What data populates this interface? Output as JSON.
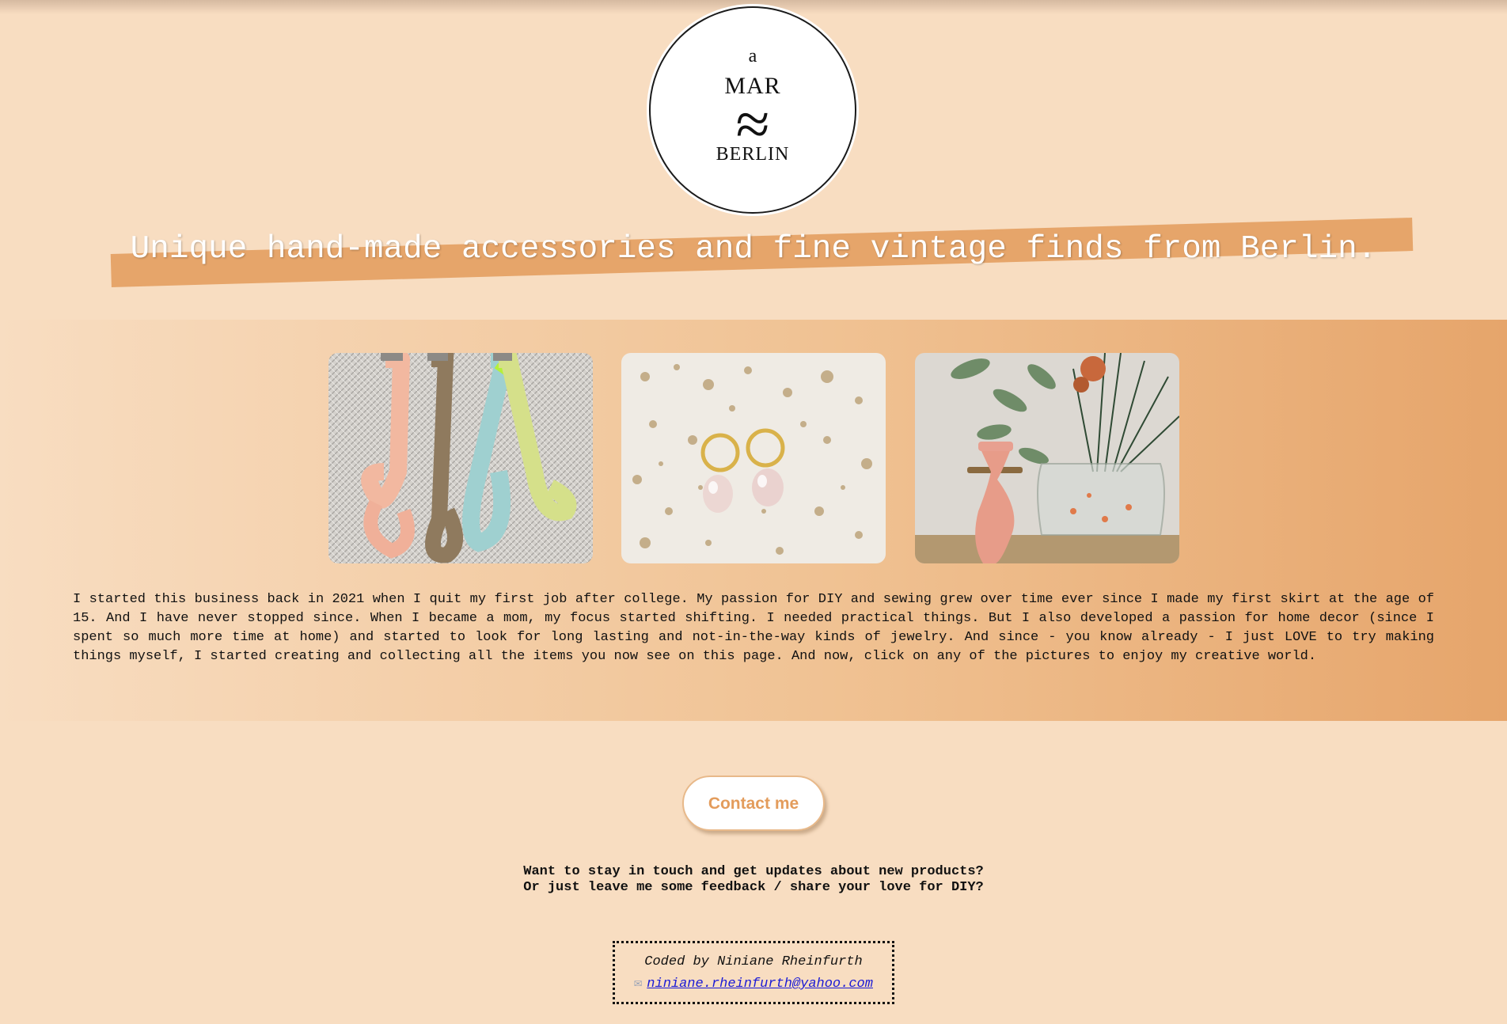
{
  "logo": {
    "line1": "a",
    "line2": "MAR",
    "line3": "≈",
    "line4": "BERLIN"
  },
  "tagline": "Unique hand-made accessories and fine vintage finds from Berlin.",
  "gallery": {
    "items": [
      {
        "name": "ribbon-straps-photo"
      },
      {
        "name": "pearl-earrings-photo"
      },
      {
        "name": "pink-vase-photo"
      }
    ]
  },
  "story": "I started this business back in 2021 when I quit my first job after college. My passion for DIY and sewing grew over time ever since I made my first skirt at the age of 15. And I have never stopped since. When I became a mom, my focus started shifting. I needed practical things. But I also developed a passion for home decor (since I spent so much more time at home) and started to look for long lasting and not-in-the-way kinds of jewelry. And since - you know already - I just LOVE to try making things myself, I started creating and collecting all the items you now see on this page. And now, click on any of the pictures to enjoy my creative world.",
  "contact": {
    "button_label": "Contact me"
  },
  "stay": {
    "line1": "Want to stay in touch and get updates about new products?",
    "line2": "Or just leave me some feedback / share your love for DIY?"
  },
  "footer": {
    "credit": "Coded by Niniane Rheinfurth",
    "email": "niniane.rheinfurth@yahoo.com",
    "mail_icon": "envelope-icon"
  },
  "colors": {
    "background": "#f8ddc1",
    "accent": "#e6a56a",
    "button_text": "#e39c5c",
    "link": "#1a1ad6"
  }
}
